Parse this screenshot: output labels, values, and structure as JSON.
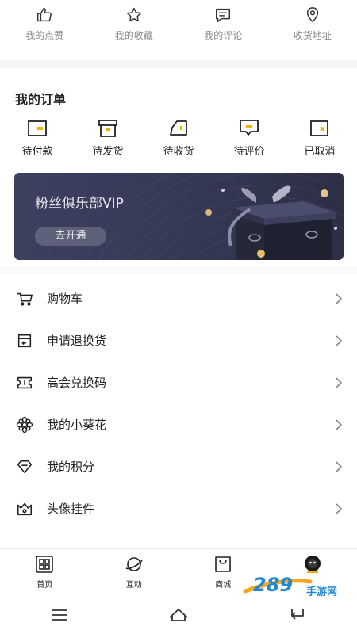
{
  "quick_links": [
    {
      "label": "我的点赞",
      "icon": "thumbs-up-icon"
    },
    {
      "label": "我的收藏",
      "icon": "star-icon"
    },
    {
      "label": "我的评论",
      "icon": "comment-icon"
    },
    {
      "label": "收货地址",
      "icon": "location-pin-icon"
    }
  ],
  "orders": {
    "title": "我的订单",
    "items": [
      {
        "label": "待付款",
        "icon": "wallet-icon"
      },
      {
        "label": "待发货",
        "icon": "box-icon"
      },
      {
        "label": "待收货",
        "icon": "truck-icon"
      },
      {
        "label": "待评价",
        "icon": "review-icon"
      },
      {
        "label": "已取消",
        "icon": "cancelled-icon"
      }
    ]
  },
  "vip": {
    "title": "粉丝俱乐部VIP",
    "button": "去开通"
  },
  "menu": [
    {
      "label": "购物车",
      "icon": "cart-icon"
    },
    {
      "label": "申请退换货",
      "icon": "return-box-icon"
    },
    {
      "label": "高会兑换码",
      "icon": "ticket-icon"
    },
    {
      "label": "我的小葵花",
      "icon": "flower-icon"
    },
    {
      "label": "我的积分",
      "icon": "diamond-icon"
    },
    {
      "label": "头像挂件",
      "icon": "crown-icon"
    }
  ],
  "tabs": [
    {
      "label": "首页",
      "icon": "home-icon"
    },
    {
      "label": "互动",
      "icon": "planet-icon"
    },
    {
      "label": "商城",
      "icon": "shopping-bag-icon"
    },
    {
      "label": "",
      "icon": "avatar-icon"
    }
  ],
  "watermark": {
    "text": "手游网",
    "logo": "289"
  },
  "colors": {
    "accent": "#f0b400",
    "banner": "#363a56",
    "text": "#222222",
    "muted": "#888888"
  }
}
